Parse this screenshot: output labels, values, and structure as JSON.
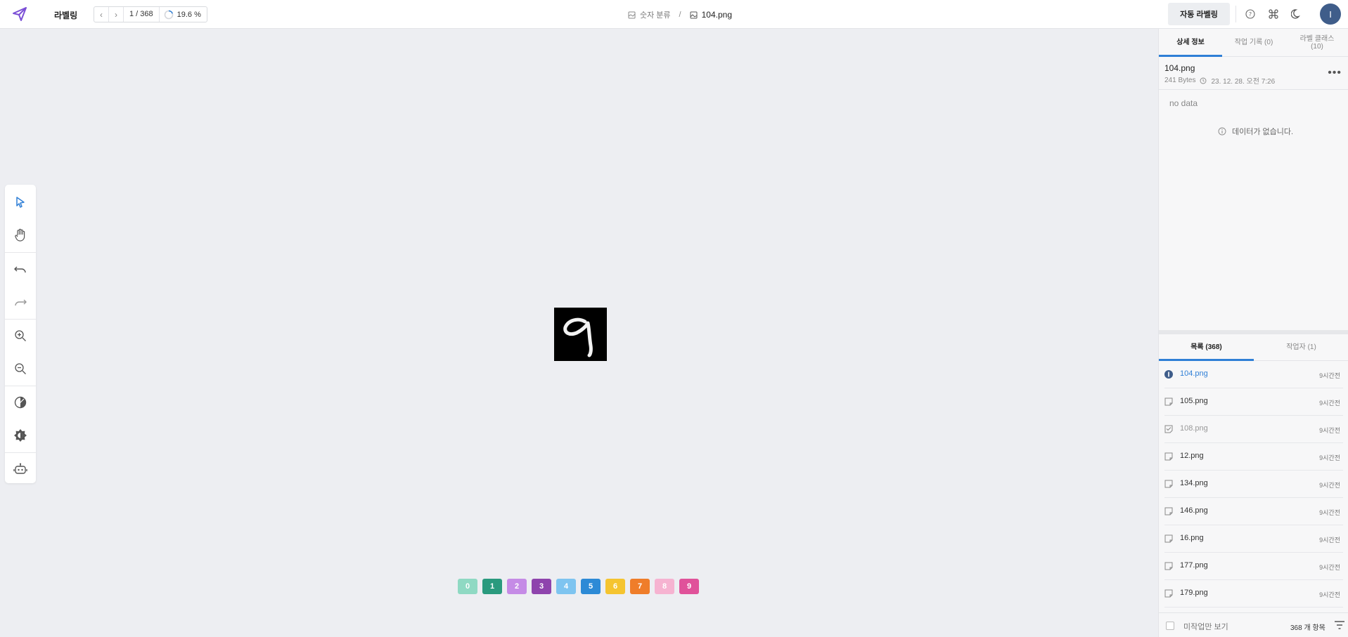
{
  "header": {
    "app_title": "라벨링",
    "nav_count": "1 / 368",
    "progress": "19.6 %",
    "progress_value": 0.196,
    "breadcrumb_project": "숫자 분류",
    "breadcrumb_sep": "/",
    "breadcrumb_file": "104.png",
    "auto_label_button": "자동 라벨링",
    "avatar_initial": "I"
  },
  "toolbar": {
    "tools": [
      "select-pointer-icon",
      "hand-pan-icon",
      "undo-icon",
      "redo-icon",
      "zoom-in-icon",
      "zoom-out-icon",
      "contrast-icon",
      "brightness-icon",
      "robot-icon"
    ]
  },
  "labels": [
    {
      "text": "0",
      "color": "#8fd9c3"
    },
    {
      "text": "1",
      "color": "#2a9a7e"
    },
    {
      "text": "2",
      "color": "#c58be6"
    },
    {
      "text": "3",
      "color": "#8e44ad"
    },
    {
      "text": "4",
      "color": "#7ec4f0"
    },
    {
      "text": "5",
      "color": "#2d8ad6"
    },
    {
      "text": "6",
      "color": "#f5c430"
    },
    {
      "text": "7",
      "color": "#ef7d2a"
    },
    {
      "text": "8",
      "color": "#f6b3d1"
    },
    {
      "text": "9",
      "color": "#e0529a"
    }
  ],
  "panel": {
    "tabs": [
      "상세 정보",
      "작업 기록 (0)",
      "라벨 클래스\n(10)"
    ],
    "file_name": "104.png",
    "file_size": "241 Bytes",
    "file_date": "23. 12. 28. 오전 7:26",
    "no_data": "no data",
    "empty_message": "데이터가 없습니다.",
    "bottom_tabs": [
      "목록 (368)",
      "작업자 (1)"
    ],
    "rows": [
      {
        "name": "104.png",
        "time": "9시간전",
        "state": "current"
      },
      {
        "name": "105.png",
        "time": "9시간전",
        "state": "todo"
      },
      {
        "name": "108.png",
        "time": "9시간전",
        "state": "done"
      },
      {
        "name": "12.png",
        "time": "9시간전",
        "state": "todo"
      },
      {
        "name": "134.png",
        "time": "9시간전",
        "state": "todo"
      },
      {
        "name": "146.png",
        "time": "9시간전",
        "state": "todo"
      },
      {
        "name": "16.png",
        "time": "9시간전",
        "state": "todo"
      },
      {
        "name": "177.png",
        "time": "9시간전",
        "state": "todo"
      },
      {
        "name": "179.png",
        "time": "9시간전",
        "state": "todo"
      }
    ],
    "filter_label": "미작업만 보기",
    "count_label": "368 개 항목"
  },
  "colors": {
    "accent": "#2f7fd6",
    "avatar": "#3f5d8a",
    "logo": "#7b4fd6"
  }
}
